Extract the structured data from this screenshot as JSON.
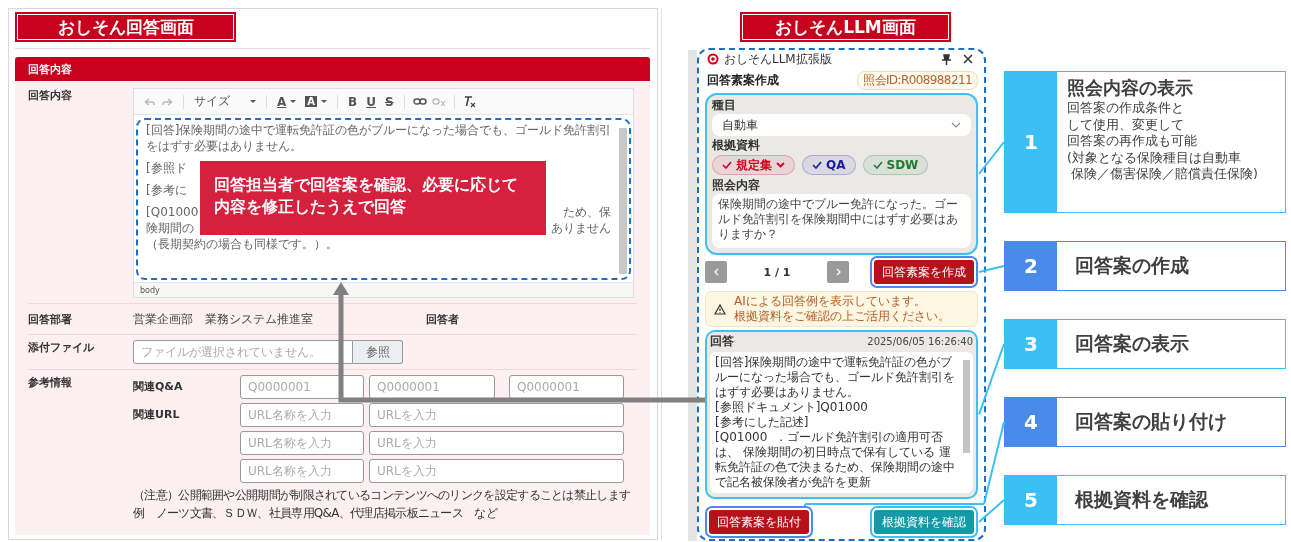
{
  "left_title": "おしそん回答画面",
  "answer_section": {
    "title": "回答内容",
    "answer": {
      "label": "回答内容",
      "toolbar": {
        "size": "サイズ",
        "text_color": "A",
        "highlight": "A",
        "bold": "B",
        "underline": "U",
        "strike": "S"
      },
      "lines": [
        {
          "start": "[回答]保険期間の途中で運転免許証の色がブルーになった場合でも、ゴールド免許割引をはずす必要はありません。"
        },
        {
          "start": "[参照ド"
        },
        {
          "start": "[参考に"
        },
        {
          "start": "[Q01000",
          "end": "ため、保"
        },
        {
          "start": "険期間の",
          "end": "ありません"
        },
        {
          "start": "（長期契約の場合も同様です。）。"
        }
      ],
      "status": "body"
    },
    "department": {
      "label": "回答部署",
      "value": "営業企画部　業務システム推進室",
      "responder_label": "回答者"
    },
    "attachment": {
      "label": "添付ファイル",
      "placeholder": "ファイルが選択されていません。",
      "button": "参照"
    },
    "reference": {
      "label": "参考情報",
      "qa_label": "関連Q&A",
      "qa_placeholders": [
        "Q0000001",
        "Q0000001",
        "Q0000001"
      ],
      "url_label": "関連URL",
      "url_rows": [
        {
          "name_placeholder": "URL名称を入力",
          "url_placeholder": "URLを入力"
        },
        {
          "name_placeholder": "URL名称を入力",
          "url_placeholder": "URLを入力"
        },
        {
          "name_placeholder": "URL名称を入力",
          "url_placeholder": "URLを入力"
        }
      ],
      "notes": [
        "（注意）公開範囲や公開期間が制限されているコンテンツへのリンクを設定することは禁止します",
        "例　ノーツ文書、ＳＤＷ、社員専用Q&A、代理店掲示板ニュース　など"
      ]
    }
  },
  "overlay_note_lines": [
    "回答担当者で回答案を確認、必要に応じて",
    "内容を修正したうえで回答"
  ],
  "right_title": "おしそんLLM画面",
  "llm": {
    "app_title": "おしそんLLM拡張版",
    "heading": "回答素案作成",
    "inquiry_id": "照会ID:R008988211",
    "category_label": "種目",
    "category_value": "自動車",
    "sources_label": "根拠資料",
    "sources": [
      {
        "label": "規定集",
        "checked": true,
        "color": "#d0021b",
        "kind": "dropdown"
      },
      {
        "label": "QA",
        "checked": true,
        "color": "#1a1aa6",
        "kind": "toggle"
      },
      {
        "label": "SDW",
        "checked": true,
        "color": "#1f7a2e",
        "kind": "toggle"
      }
    ],
    "inquiry_label": "照会内容",
    "inquiry_text": "保険期間の途中でブルー免許になった。ゴールド免許割引を保険期間中にはずす必要はありますか？",
    "pager": "1 / 1",
    "create_button": "回答素案を作成",
    "warning_lines": [
      "AIによる回答例を表示しています。",
      "根拠資料をご確認の上ご活用ください。"
    ],
    "answer_label": "回答",
    "answer_time": "2025/06/05 16:26:40",
    "answer_paragraphs": [
      "[回答]保険期間の途中で運転免許証の色がブルーになった場合でも、ゴールド免許割引をはずす必要はありません。",
      "[参照ドキュメント]Q01000",
      "[参考にした記述]",
      "[Q01000　. ゴールド免許割引の適用可否は、 保険期間の初日時点で保有している 運転免許証の色で決まるため、保険期間の途中で記名被保険者が免許を更新"
    ],
    "paste_button": "回答素案を貼付",
    "check_button": "根拠資料を確認"
  },
  "callouts": [
    {
      "number": "1",
      "title": "照会内容の表示",
      "description_lines": [
        "回答案の作成条件と",
        "して使用、変更して",
        "回答案の再作成も可能",
        "(対象となる保険種目は自動車",
        " 保険／傷害保険／賠償責任保険)"
      ],
      "color": "#3bbff5"
    },
    {
      "number": "2",
      "title": "回答案の作成",
      "color": "#4a8ae8"
    },
    {
      "number": "3",
      "title": "回答案の表示",
      "color": "#3bbff5"
    },
    {
      "number": "4",
      "title": "回答案の貼り付け",
      "color": "#4a8ae8"
    },
    {
      "number": "5",
      "title": "根拠資料を確認",
      "color": "#3bbff5"
    }
  ]
}
